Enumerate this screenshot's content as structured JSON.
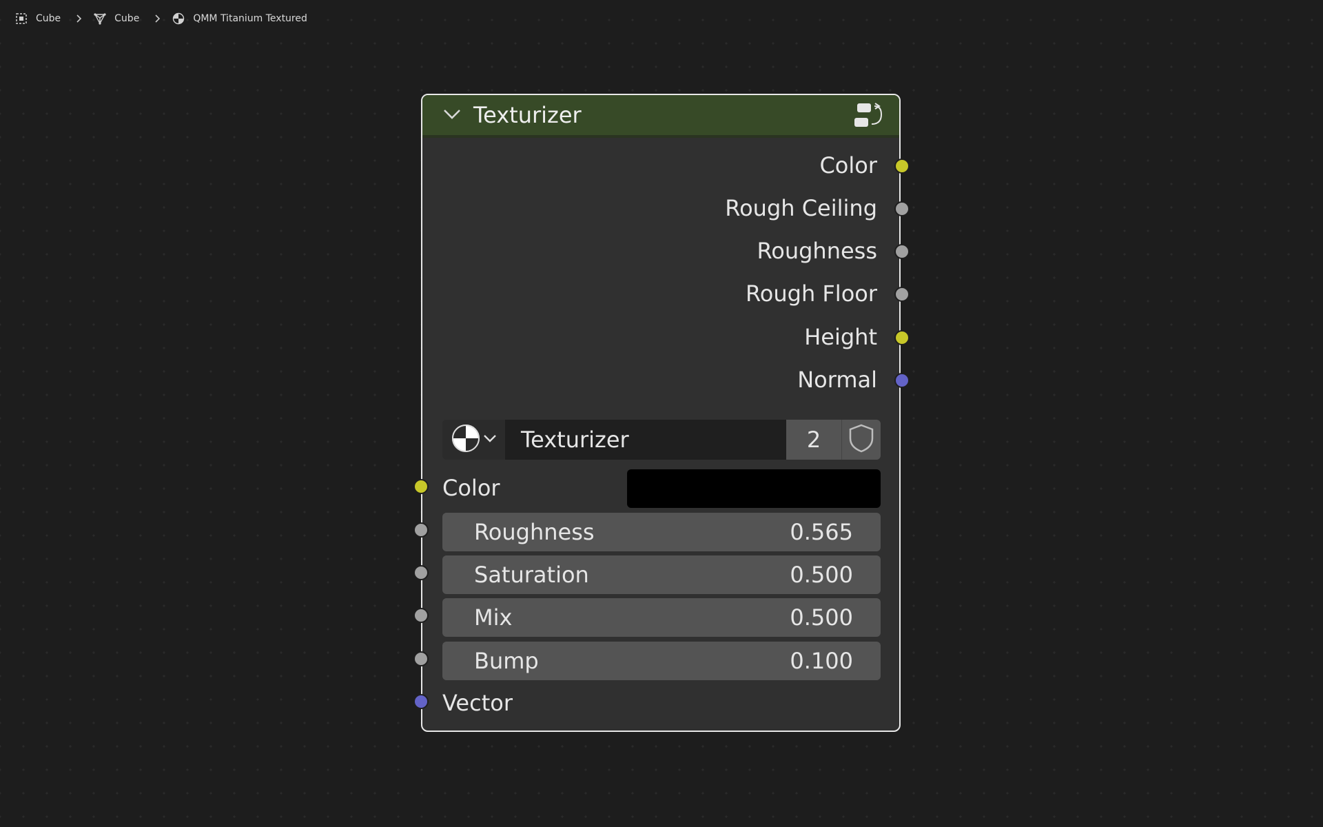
{
  "breadcrumb": {
    "items": [
      {
        "label": "Cube",
        "icon": "object-icon"
      },
      {
        "label": "Cube",
        "icon": "mesh-data-icon"
      },
      {
        "label": "QMM Titanium Textured",
        "icon": "material-icon"
      }
    ]
  },
  "node": {
    "title": "Texturizer",
    "header_color": "#374a27",
    "outputs": [
      {
        "label": "Color",
        "type": "color",
        "socket_color": "#c7c729"
      },
      {
        "label": "Rough Ceiling",
        "type": "float",
        "socket_color": "#a1a1a1"
      },
      {
        "label": "Roughness",
        "type": "float",
        "socket_color": "#a1a1a1"
      },
      {
        "label": "Rough Floor",
        "type": "float",
        "socket_color": "#a1a1a1"
      },
      {
        "label": "Height",
        "type": "color",
        "socket_color": "#c7c729"
      },
      {
        "label": "Normal",
        "type": "vector",
        "socket_color": "#6363c7"
      }
    ],
    "datablock": {
      "name": "Texturizer",
      "users": "2"
    },
    "inputs": {
      "color": {
        "label": "Color",
        "value": "#000000"
      },
      "sliders": [
        {
          "label": "Roughness",
          "value": "0.565"
        },
        {
          "label": "Saturation",
          "value": "0.500"
        },
        {
          "label": "Mix",
          "value": "0.500"
        },
        {
          "label": "Bump",
          "value": "0.100"
        }
      ],
      "vector": {
        "label": "Vector"
      }
    }
  }
}
